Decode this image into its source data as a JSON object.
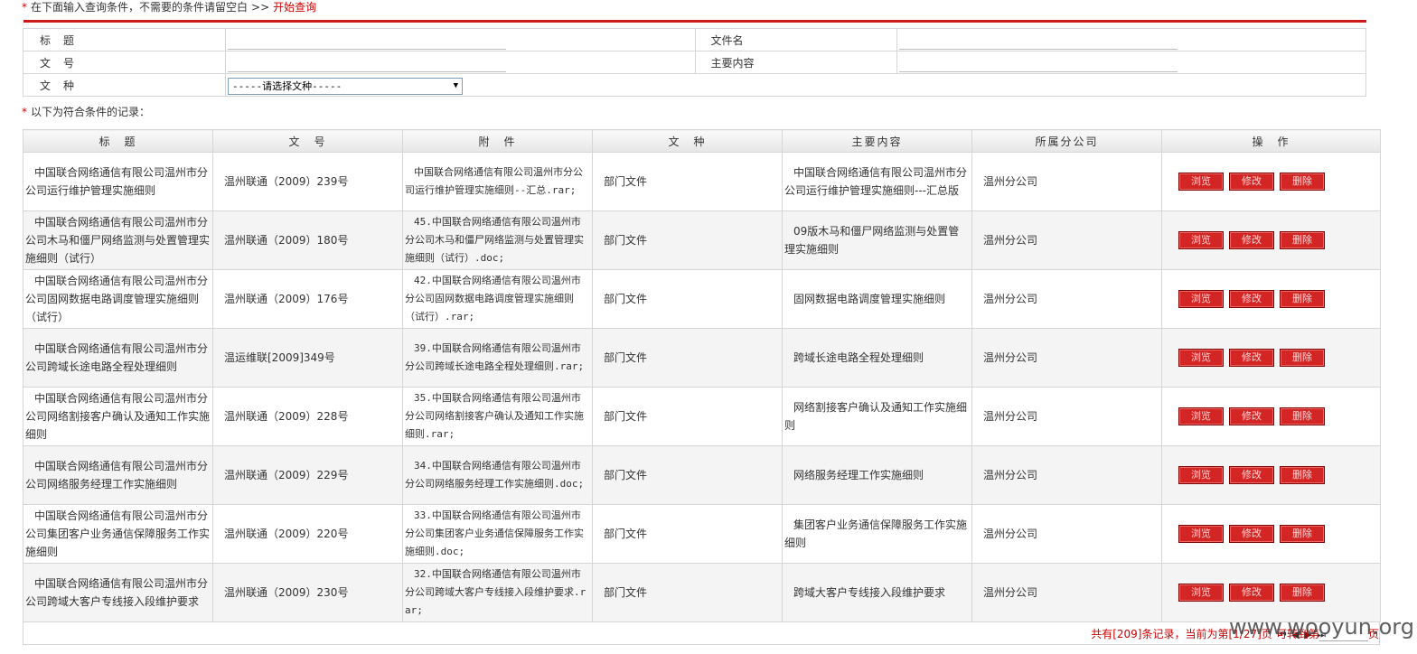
{
  "query_hint": {
    "text": "在下面输入查询条件，不需要的条件请留空白",
    "arrow": ">>",
    "link": "开始查询"
  },
  "search_form": {
    "title_label": "标　题",
    "filename_label": "文件名",
    "docno_label": "文　号",
    "content_label": "主要内容",
    "doctype_label": "文　种",
    "doctype_select": "-----请选择文种-----"
  },
  "results_hint": "以下为符合条件的记录：",
  "table": {
    "headers": [
      "标　题",
      "文　号",
      "附　件",
      "文　种",
      "主要内容",
      "所属分公司",
      "操　作"
    ],
    "rows": [
      {
        "title": "中国联合网络通信有限公司温州市分公司运行维护管理实施细则",
        "docno": "温州联通（2009）239号",
        "attachment": "中国联合网络通信有限公司温州市分公司运行维护管理实施细则--汇总.rar;",
        "doctype": "部门文件",
        "content": "中国联合网络通信有限公司温州市分公司运行维护管理实施细则---汇总版",
        "branch": "温州分公司"
      },
      {
        "title": "中国联合网络通信有限公司温州市分公司木马和僵尸网络监测与处置管理实施细则（试行）",
        "docno": "温州联通（2009）180号",
        "attachment": "45.中国联合网络通信有限公司温州市分公司木马和僵尸网络监测与处置管理实施细则（试行）.doc;",
        "doctype": "部门文件",
        "content": "09版木马和僵尸网络监测与处置管理实施细则",
        "branch": "温州分公司"
      },
      {
        "title": "中国联合网络通信有限公司温州市分公司固网数据电路调度管理实施细则（试行）",
        "docno": "温州联通（2009）176号",
        "attachment": "42.中国联合网络通信有限公司温州市分公司固网数据电路调度管理实施细则（试行）.rar;",
        "doctype": "部门文件",
        "content": "固网数据电路调度管理实施细则",
        "branch": "温州分公司"
      },
      {
        "title": "中国联合网络通信有限公司温州市分公司跨域长途电路全程处理细则",
        "docno": "温运维联[2009]349号",
        "attachment": "39.中国联合网络通信有限公司温州市分公司跨域长途电路全程处理细则.rar;",
        "doctype": "部门文件",
        "content": "跨域长途电路全程处理细则",
        "branch": "温州分公司"
      },
      {
        "title": "中国联合网络通信有限公司温州市分公司网络割接客户确认及通知工作实施细则",
        "docno": "温州联通（2009）228号",
        "attachment": "35.中国联合网络通信有限公司温州市分公司网络割接客户确认及通知工作实施细则.rar;",
        "doctype": "部门文件",
        "content": "网络割接客户确认及通知工作实施细则",
        "branch": "温州分公司"
      },
      {
        "title": "中国联合网络通信有限公司温州市分公司网络服务经理工作实施细则",
        "docno": "温州联通（2009）229号",
        "attachment": "34.中国联合网络通信有限公司温州市分公司网络服务经理工作实施细则.doc;",
        "doctype": "部门文件",
        "content": "网络服务经理工作实施细则",
        "branch": "温州分公司"
      },
      {
        "title": "中国联合网络通信有限公司温州市分公司集团客户业务通信保障服务工作实施细则",
        "docno": "温州联通（2009）220号",
        "attachment": "33.中国联合网络通信有限公司温州市分公司集团客户业务通信保障服务工作实施细则.doc;",
        "doctype": "部门文件",
        "content": "集团客户业务通信保障服务工作实施细则",
        "branch": "温州分公司"
      },
      {
        "title": "中国联合网络通信有限公司温州市分公司跨域大客户专线接入段维护要求",
        "docno": "温州联通（2009）230号",
        "attachment": "32.中国联合网络通信有限公司温州市分公司跨域大客户专线接入段维护要求.rar;",
        "doctype": "部门文件",
        "content": "跨域大客户专线接入段维护要求",
        "branch": "温州分公司"
      }
    ],
    "buttons": {
      "view": "浏览",
      "edit": "修改",
      "delete": "删除"
    }
  },
  "pager": {
    "summary": "共有[209]条记录，当前为第[1/27]页",
    "nav": "⏮ ◀ ▶ ⏭",
    "jump_prefix": "可转到第",
    "jump_suffix": "页"
  },
  "watermark": "www.wooyun.org"
}
